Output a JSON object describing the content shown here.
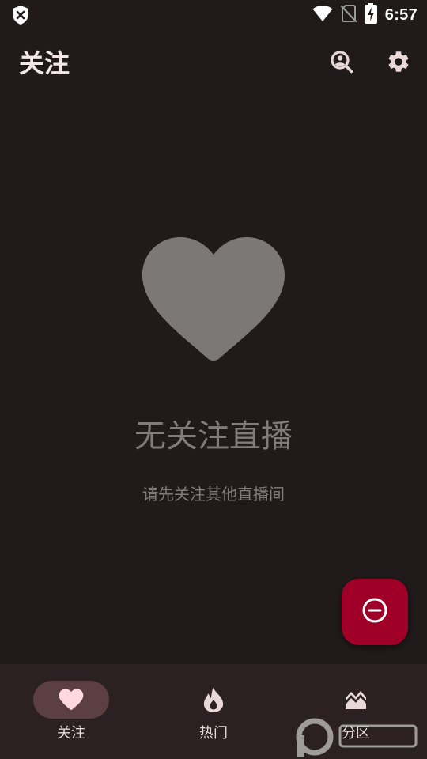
{
  "status_bar": {
    "time": "6:57",
    "icons": [
      "shield-x-icon",
      "wifi-icon",
      "no-sim-icon",
      "battery-charging-icon"
    ]
  },
  "app_bar": {
    "title": "关注",
    "actions": [
      "search-person-icon",
      "gear-icon"
    ]
  },
  "empty_state": {
    "icon": "heart-icon",
    "title": "无关注直播",
    "subtitle": "请先关注其他直播间"
  },
  "fab": {
    "icon": "minus-circle-icon"
  },
  "bottom_nav": {
    "items": [
      {
        "label": "关注",
        "icon": "heart-icon",
        "active": true
      },
      {
        "label": "热门",
        "icon": "fire-icon",
        "active": false
      },
      {
        "label": "分区",
        "icon": "landscape-icon",
        "active": false
      }
    ]
  },
  "colors": {
    "background": "#201a1b",
    "nav_background": "#2b2122",
    "nav_indicator": "#5b3f42",
    "fab": "#a00028",
    "muted": "#837b7b"
  }
}
